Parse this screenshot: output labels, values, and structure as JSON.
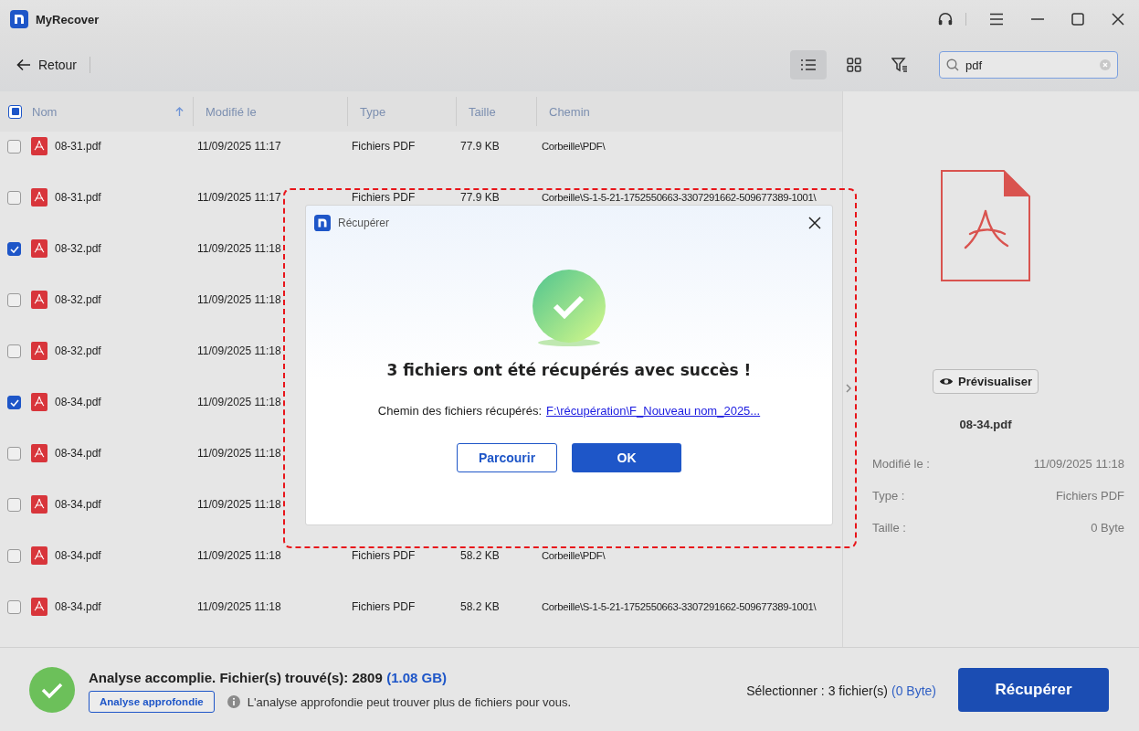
{
  "app": {
    "title": "MyRecover"
  },
  "toolbar": {
    "back": "Retour",
    "views": [
      {
        "kind": "list",
        "selected": true
      },
      {
        "kind": "grid",
        "selected": false
      }
    ],
    "search": {
      "value": "pdf"
    }
  },
  "table": {
    "header_checkbox": {
      "indeterminate": true
    },
    "columns": [
      {
        "label": "Nom",
        "sorted": true
      },
      {
        "label": "Modifié le",
        "sorted": false
      },
      {
        "label": "Type",
        "sorted": false
      },
      {
        "label": "Taille",
        "sorted": false
      },
      {
        "label": "Chemin",
        "sorted": false
      }
    ],
    "rows": [
      {
        "checked": false,
        "name": "08-31.pdf",
        "modified": "11/09/2025 11:17",
        "type": "Fichiers PDF",
        "size": "77.9 KB",
        "path": "Corbeille\\PDF\\"
      },
      {
        "checked": false,
        "name": "08-31.pdf",
        "modified": "11/09/2025 11:17",
        "type": "Fichiers PDF",
        "size": "77.9 KB",
        "path": "Corbeille\\S-1-5-21-1752550663-3307291662-509677389-1001\\"
      },
      {
        "checked": true,
        "name": "08-32.pdf",
        "modified": "11/09/2025 11:18"
      },
      {
        "checked": false,
        "name": "08-32.pdf",
        "modified": "11/09/2025 11:18"
      },
      {
        "checked": false,
        "name": "08-32.pdf",
        "modified": "11/09/2025 11:18"
      },
      {
        "checked": true,
        "name": "08-34.pdf",
        "modified": "11/09/2025 11:18"
      },
      {
        "checked": false,
        "name": "08-34.pdf",
        "modified": "11/09/2025 11:18"
      },
      {
        "checked": false,
        "name": "08-34.pdf",
        "modified": "11/09/2025 11:18"
      },
      {
        "checked": false,
        "name": "08-34.pdf",
        "modified": "11/09/2025 11:18",
        "type": "Fichiers PDF",
        "size": "58.2 KB",
        "path": "Corbeille\\PDF\\"
      },
      {
        "checked": false,
        "name": "08-34.pdf",
        "modified": "11/09/2025 11:18",
        "type": "Fichiers PDF",
        "size": "58.2 KB",
        "path": "Corbeille\\S-1-5-21-1752550663-3307291662-509677389-1001\\"
      }
    ]
  },
  "preview": {
    "button": "Prévisualiser",
    "filename": "08-34.pdf",
    "details": [
      {
        "label": "Modifié le :",
        "value": "11/09/2025 11:18"
      },
      {
        "label": "Type :",
        "value": "Fichiers PDF"
      },
      {
        "label": "Taille :",
        "value": "0 Byte"
      }
    ]
  },
  "dialog": {
    "title": "Récupérer",
    "message": "3 fichiers ont été récupérés avec succès !",
    "path_label": "Chemin des fichiers récupérés:",
    "path_link": "F:\\récupération\\F_Nouveau nom_2025...",
    "buttons": [
      {
        "label": "Parcourir",
        "kind": "secondary"
      },
      {
        "label": "OK",
        "kind": "primary"
      }
    ]
  },
  "status": {
    "summary": "Analyse accomplie. Fichier(s) trouvé(s): 2809",
    "summary_size": "(1.08 GB)",
    "deep_scan_button": "Analyse approfondie",
    "hint": "L'analyse approfondie peut trouver plus de fichiers pour vous.",
    "selection": "Sélectionner : 3 fichier(s)",
    "selection_size": "(0 Byte)",
    "recover_button": "Récupérer"
  }
}
